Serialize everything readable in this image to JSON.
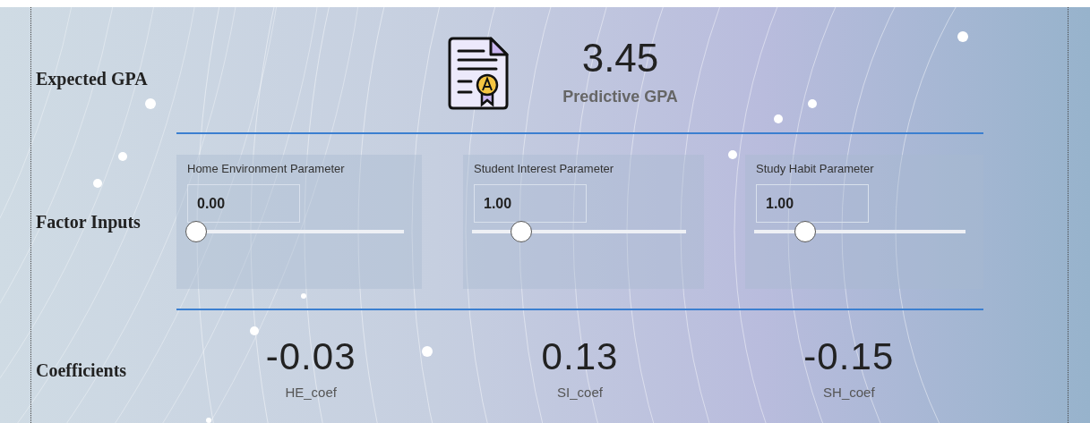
{
  "gpa_section": {
    "label": "Expected GPA",
    "value": "3.45",
    "caption": "Predictive GPA"
  },
  "inputs_section": {
    "label": "Factor Inputs",
    "parameters": [
      {
        "title": "Home Environment Parameter",
        "value": "0.00",
        "level": 0
      },
      {
        "title": "Student Interest Parameter",
        "value": "1.00",
        "level": 0.2
      },
      {
        "title": "Study Habit Parameter",
        "value": "1.00",
        "level": 0.21
      }
    ]
  },
  "coefficients_section": {
    "label": "Coefficients",
    "items": [
      {
        "value": "-0.03",
        "caption": "HE_coef"
      },
      {
        "value": "0.13",
        "caption": "SI_coef"
      },
      {
        "value": "-0.15",
        "caption": "SH_coef"
      }
    ]
  }
}
